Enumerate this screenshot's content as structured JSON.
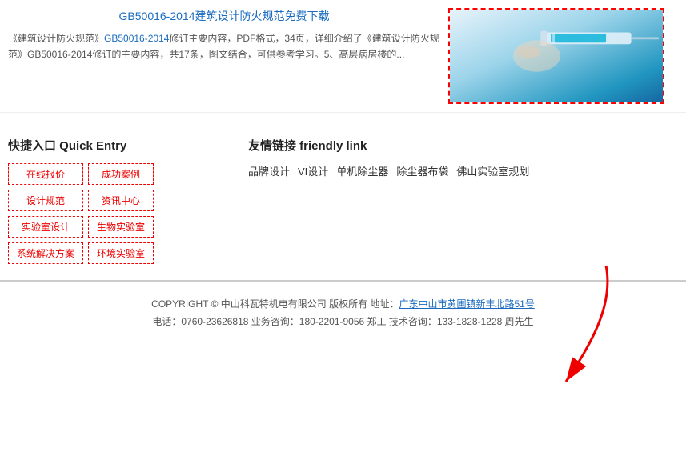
{
  "top": {
    "article": {
      "title": "GB50016-2014建筑设计防火规范免费下载",
      "body_parts": [
        "《建筑设计防火规范》",
        "GB50016-2014修订主要内容，PDF格式，34页，详细介绍了《建筑设计防火规范》GB50016-2014修订的主要内容，共17条，图文结合，可供参考学习。5、高层病房楼的..."
      ],
      "link_text": "GB50016-2014"
    }
  },
  "quick_entry": {
    "heading": "快捷入口 Quick Entry",
    "buttons": [
      "在线报价",
      "成功案例",
      "设计规范",
      "资讯中心",
      "实验室设计",
      "生物实验室",
      "系统解决方案",
      "环境实验室"
    ]
  },
  "friendly_links": {
    "heading": "友情链接 friendly link",
    "links": [
      "品牌设计",
      "VI设计",
      "单机除尘器",
      "除尘器布袋",
      "佛山实验室规划"
    ]
  },
  "footer": {
    "copyright_text": "COPYRIGHT © 中山科瓦特机电有限公司 版权所有 地址：",
    "address_link": "广东中山市黄圃镇新丰北路51号",
    "phone_line": "电话：0760-23626818 业务咨询：180-2201-9056 郑工 技术咨询：133-1828-1228 周先生"
  }
}
